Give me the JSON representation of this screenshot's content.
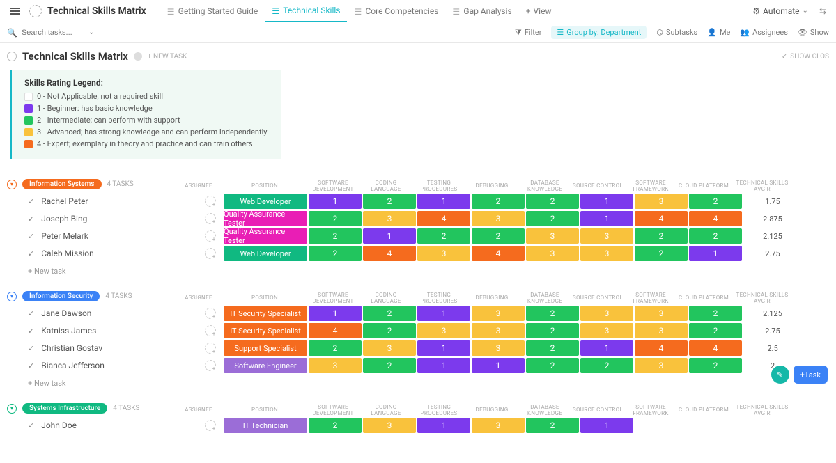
{
  "header": {
    "title": "Technical Skills Matrix",
    "tabs": [
      {
        "label": "Getting Started Guide",
        "active": false
      },
      {
        "label": "Technical Skills",
        "active": true
      },
      {
        "label": "Core Competencies",
        "active": false
      },
      {
        "label": "Gap Analysis",
        "active": false
      },
      {
        "label": "View",
        "add": true
      }
    ],
    "automate": "Automate"
  },
  "filterbar": {
    "search_placeholder": "Search tasks...",
    "filter": "Filter",
    "groupby": "Group by: Department",
    "subtasks": "Subtasks",
    "me": "Me",
    "assignees": "Assignees",
    "show": "Show"
  },
  "page": {
    "title": "Technical Skills Matrix",
    "new_task": "+ NEW TASK",
    "show_close": "SHOW CLOS"
  },
  "legend": {
    "title": "Skills Rating Legend:",
    "items": [
      {
        "color": "#ffffff",
        "text": "0 - Not Applicable; not a required skill"
      },
      {
        "color": "#7c3aed",
        "text": "1 - Beginner:  has basic knowledge"
      },
      {
        "color": "#22c55e",
        "text": "2 - Intermediate; can perform with support"
      },
      {
        "color": "#f9c23c",
        "text": "3 - Advanced; has strong knowledge and can perform independently"
      },
      {
        "color": "#f56b1e",
        "text": "4 - Expert; exemplary in theory and practice and can train others"
      }
    ]
  },
  "columns": {
    "assignee": "ASSIGNEE",
    "position": "POSITION",
    "skills": [
      "SOFTWARE DEVELOPMENT",
      "CODING LANGUAGE",
      "TESTING PROCEDURES",
      "DEBUGGING",
      "DATABASE KNOWLEDGE",
      "SOURCE CONTROL",
      "SOFTWARE FRAMEWORK",
      "CLOUD PLATFORM"
    ],
    "avg": "TECHNICAL SKILLS AVG R"
  },
  "groups": [
    {
      "name": "Information Systems",
      "color": "#f56b1e",
      "count": "4 TASKS",
      "rows": [
        {
          "name": "Rachel Peter",
          "position": "Web Developer",
          "pos_color": "c-teal",
          "skills": [
            1,
            2,
            1,
            2,
            2,
            1,
            3,
            2
          ],
          "avg": "1.75"
        },
        {
          "name": "Joseph Bing",
          "position": "Quality Assurance Tester",
          "pos_color": "c-magenta",
          "skills": [
            2,
            3,
            4,
            3,
            2,
            1,
            4,
            4
          ],
          "avg": "2.875"
        },
        {
          "name": "Peter Melark",
          "position": "Quality Assurance Tester",
          "pos_color": "c-magenta",
          "skills": [
            2,
            1,
            2,
            2,
            3,
            3,
            2,
            2
          ],
          "avg": "2.125"
        },
        {
          "name": "Caleb Mission",
          "position": "Web Developer",
          "pos_color": "c-teal",
          "skills": [
            2,
            4,
            3,
            4,
            3,
            3,
            2,
            1
          ],
          "avg": "2.75"
        }
      ]
    },
    {
      "name": "Information Security",
      "color": "#3b82f6",
      "count": "4 TASKS",
      "rows": [
        {
          "name": "Jane Dawson",
          "position": "IT Security Specialist",
          "pos_color": "c-orange",
          "skills": [
            1,
            2,
            1,
            3,
            2,
            3,
            3,
            2
          ],
          "avg": "2.125"
        },
        {
          "name": "Katniss James",
          "position": "IT Security Specialist",
          "pos_color": "c-orange",
          "skills": [
            4,
            2,
            3,
            3,
            2,
            3,
            3,
            2
          ],
          "avg": "2.75"
        },
        {
          "name": "Christian Gostav",
          "position": "Support Specialist",
          "pos_color": "c-orange",
          "skills": [
            2,
            3,
            1,
            3,
            2,
            1,
            4,
            4
          ],
          "avg": "2.5"
        },
        {
          "name": "Bianca Jefferson",
          "position": "Software Engineer",
          "pos_color": "c-lav",
          "skills": [
            3,
            2,
            1,
            1,
            2,
            2,
            3,
            2
          ],
          "avg": "2"
        }
      ]
    },
    {
      "name": "Systems Infrastructure",
      "color": "#10b981",
      "count": "4 TASKS",
      "rows": [
        {
          "name": "John Doe",
          "position": "IT Technician",
          "pos_color": "c-lav",
          "skills": [
            2,
            3,
            1,
            3,
            2,
            1,
            null,
            null
          ],
          "avg": ""
        }
      ]
    }
  ],
  "skill_colors": {
    "1": "c-purple",
    "2": "c-green",
    "3": "c-yellow",
    "4": "c-orange"
  },
  "new_task_row": "+ New task",
  "float": {
    "task": "Task"
  }
}
